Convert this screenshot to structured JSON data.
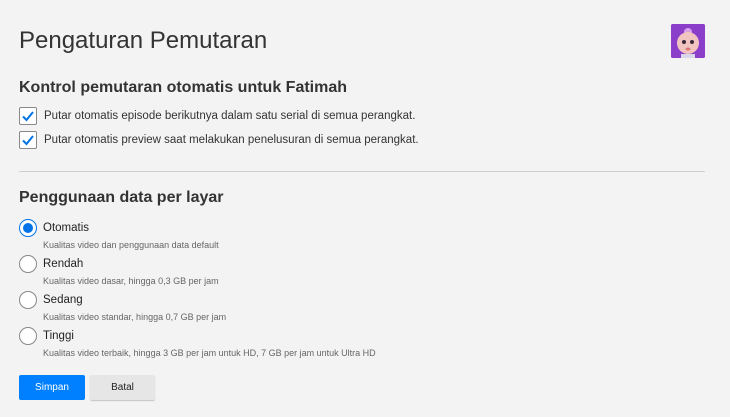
{
  "page": {
    "title": "Pengaturan Pemutaran"
  },
  "autoplay": {
    "heading": "Kontrol pemutaran otomatis untuk Fatimah",
    "options": [
      {
        "label": "Putar otomatis episode berikutnya dalam satu serial di semua perangkat.",
        "checked": true
      },
      {
        "label": "Putar otomatis preview saat melakukan penelusuran di semua perangkat.",
        "checked": true
      }
    ]
  },
  "data_usage": {
    "heading": "Penggunaan data per layar",
    "options": [
      {
        "label": "Otomatis",
        "desc": "Kualitas video dan penggunaan data default",
        "selected": true
      },
      {
        "label": "Rendah",
        "desc": "Kualitas video dasar, hingga 0,3 GB per jam",
        "selected": false
      },
      {
        "label": "Sedang",
        "desc": "Kualitas video standar, hingga 0,7 GB per jam",
        "selected": false
      },
      {
        "label": "Tinggi",
        "desc": "Kualitas video terbaik, hingga 3 GB per jam untuk HD, 7 GB per jam untuk Ultra HD",
        "selected": false
      }
    ]
  },
  "buttons": {
    "save": "Simpan",
    "cancel": "Batal"
  },
  "colors": {
    "accent": "#0073e6",
    "save_button": "#0080ff",
    "avatar_bg": "#8a3ec9"
  },
  "icons": {
    "avatar": "profile-avatar-icon",
    "check": "checkmark-icon"
  }
}
